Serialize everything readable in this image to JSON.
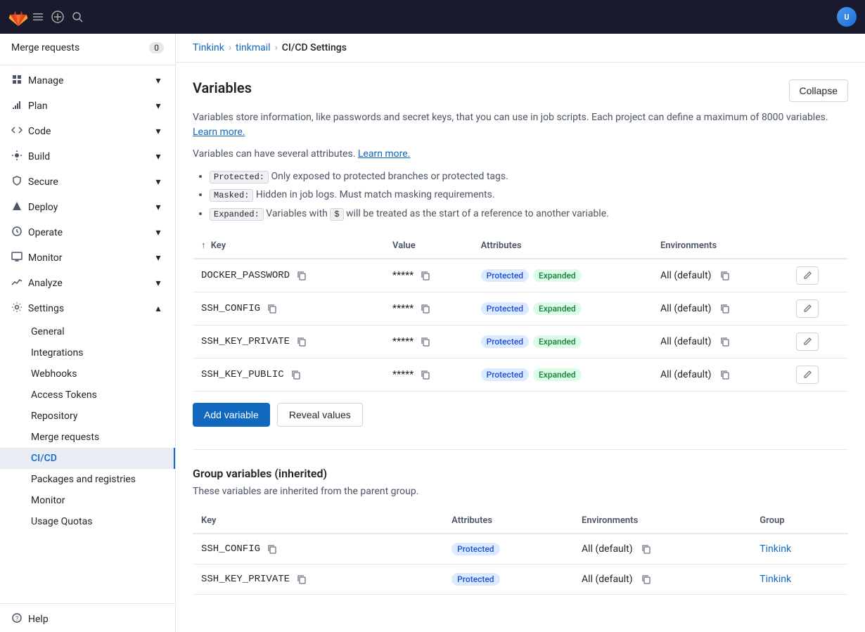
{
  "topbar": {
    "logo_alt": "GitLab",
    "toggle_sidebar_label": "Toggle sidebar",
    "create_new_label": "Create new",
    "search_label": "Search",
    "avatar_initials": "U"
  },
  "breadcrumb": {
    "org": "Tinkink",
    "repo": "tinkmail",
    "page": "CI/CD Settings"
  },
  "sidebar": {
    "merge_requests_label": "Merge requests",
    "merge_requests_count": "0",
    "groups": [
      {
        "id": "manage",
        "label": "Manage",
        "icon": "manage-icon"
      },
      {
        "id": "plan",
        "label": "Plan",
        "icon": "plan-icon"
      },
      {
        "id": "code",
        "label": "Code",
        "icon": "code-icon"
      },
      {
        "id": "build",
        "label": "Build",
        "icon": "build-icon"
      },
      {
        "id": "secure",
        "label": "Secure",
        "icon": "secure-icon"
      },
      {
        "id": "deploy",
        "label": "Deploy",
        "icon": "deploy-icon"
      },
      {
        "id": "operate",
        "label": "Operate",
        "icon": "operate-icon"
      },
      {
        "id": "monitor",
        "label": "Monitor",
        "icon": "monitor-icon"
      },
      {
        "id": "analyze",
        "label": "Analyze",
        "icon": "analyze-icon"
      },
      {
        "id": "settings",
        "label": "Settings",
        "icon": "settings-icon"
      }
    ],
    "settings_sub": [
      {
        "id": "general",
        "label": "General",
        "active": false
      },
      {
        "id": "integrations",
        "label": "Integrations",
        "active": false
      },
      {
        "id": "webhooks",
        "label": "Webhooks",
        "active": false
      },
      {
        "id": "access-tokens",
        "label": "Access Tokens",
        "active": false
      },
      {
        "id": "repository",
        "label": "Repository",
        "active": false
      },
      {
        "id": "merge-requests",
        "label": "Merge requests",
        "active": false
      },
      {
        "id": "cicd",
        "label": "CI/CD",
        "active": true
      },
      {
        "id": "packages-registries",
        "label": "Packages and registries",
        "active": false
      },
      {
        "id": "monitor",
        "label": "Monitor",
        "active": false
      },
      {
        "id": "usage-quotas",
        "label": "Usage Quotas",
        "active": false
      }
    ],
    "help_label": "Help"
  },
  "variables_section": {
    "title": "Variables",
    "collapse_button": "Collapse",
    "desc1": "Variables store information, like passwords and secret keys, that you can use in job scripts. Each project can define a maximum of 8000 variables.",
    "learn_more_1": "Learn more.",
    "desc2": "Variables can have several attributes.",
    "learn_more_2": "Learn more.",
    "attributes_list": [
      {
        "tag": "Protected:",
        "desc": "Only exposed to protected branches or protected tags."
      },
      {
        "tag": "Masked:",
        "desc": "Hidden in job logs. Must match masking requirements."
      },
      {
        "tag": "Expanded:",
        "desc": "Variables with",
        "code": "$",
        "desc2": "will be treated as the start of a reference to another variable."
      }
    ],
    "table_headers": {
      "key": "Key",
      "value": "Value",
      "attributes": "Attributes",
      "environments": "Environments"
    },
    "variables": [
      {
        "key": "DOCKER_PASSWORD",
        "value": "*****",
        "badges": [
          "Protected",
          "Expanded"
        ],
        "environment": "All (default)"
      },
      {
        "key": "SSH_CONFIG",
        "value": "*****",
        "badges": [
          "Protected",
          "Expanded"
        ],
        "environment": "All (default)"
      },
      {
        "key": "SSH_KEY_PRIVATE",
        "value": "*****",
        "badges": [
          "Protected",
          "Expanded"
        ],
        "environment": "All (default)"
      },
      {
        "key": "SSH_KEY_PUBLIC",
        "value": "*****",
        "badges": [
          "Protected",
          "Expanded"
        ],
        "environment": "All (default)"
      }
    ],
    "add_variable_btn": "Add variable",
    "reveal_values_btn": "Reveal values"
  },
  "group_variables_section": {
    "title": "Group variables (inherited)",
    "desc": "These variables are inherited from the parent group.",
    "table_headers": {
      "key": "Key",
      "attributes": "Attributes",
      "environments": "Environments",
      "group": "Group"
    },
    "variables": [
      {
        "key": "SSH_CONFIG",
        "badges": [
          "Protected"
        ],
        "environment": "All (default)",
        "group": "Tinkink",
        "group_link": "#"
      },
      {
        "key": "SSH_KEY_PRIVATE",
        "badges": [
          "Protected"
        ],
        "environment": "All (default)",
        "group": "Tinkink",
        "group_link": "#"
      }
    ]
  }
}
